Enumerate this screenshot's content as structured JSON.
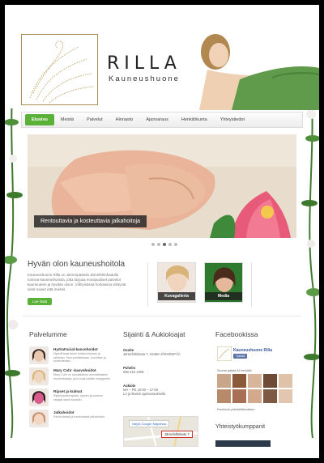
{
  "brand": {
    "name": "RILLA",
    "subtitle": "Kauneushuone"
  },
  "nav": {
    "items": [
      {
        "label": "Etusivu",
        "active": true
      },
      {
        "label": "Meistä",
        "active": false
      },
      {
        "label": "Palvelut",
        "active": false
      },
      {
        "label": "Hinnasto",
        "active": false
      },
      {
        "label": "Ajanvaraus",
        "active": false
      },
      {
        "label": "Henkilökunta",
        "active": false
      },
      {
        "label": "Yhteystiedot",
        "active": false
      }
    ]
  },
  "slider": {
    "caption": "Rentouttavia ja kosteuttavia jalkahoitoja",
    "dot_count": 5,
    "active_dot": 3
  },
  "intro": {
    "title": "Hyvän olon kauneushoitola",
    "text": "Kauneushuone Rilla on Järvenpäässä Järnefeltinkadulla toimiva kauneushoitola, joka tarjoaa monipuoliset palvelut kauneuteen ja hyvään oloon. Viihtyisässä hoitolassa viihtyvät sekä naiset että miehet.",
    "more_label": "Lue lisää"
  },
  "gallery": {
    "gallery_label": "Kuvagalleria",
    "media_label": "Media"
  },
  "services": {
    "title": "Palvelumme",
    "items": [
      {
        "name": "HydraFacial-kasvohoidot",
        "desc": "HydraFacial tekee ihosta kirkkaan ja raikkaan. Ihoa puhdistetaan, kuoritaan ja kosteutetaan."
      },
      {
        "name": "Mary Cohr -kasvohoidot",
        "desc": "Mary Cohr on ranskalainen ammattilaisten ihonhoitosarja, joka sopii kaikille ihotyypeille."
      },
      {
        "name": "Ripset ja kulmat",
        "desc": "Ripsienpidennykset, ripsien ja kulmien värjäys sekä muotoilu."
      },
      {
        "name": "Jalkahoidot",
        "desc": "Rentouttavat ja kosteuttavat jalkahoidot."
      }
    ]
  },
  "contact": {
    "title": "Sijainti & Aukioloajat",
    "address_label": "Osoite",
    "address": "Järnefeltinkatu 7, 04400 JÄRVENPÄÄ",
    "phone_label": "Puhelin",
    "phone": "050 410 1005",
    "hours_label": "Aukiolo",
    "hours": "MA – PE 10:00 – 17:00",
    "hours_note": "LA ja iltaisin ajanvarauksella",
    "map_link": "Näytä Google Mapsissa",
    "map_pin": "Järnefeltinkatu 7"
  },
  "facebook": {
    "title": "Facebookissa",
    "page_name": "Kauneushuone Rilla",
    "like_label": "Tykkää",
    "count_text": "Sivusta tykkää 94 henkilöä",
    "plugin_text": "Facebook-yhteisöliitännäinen"
  },
  "partners": {
    "title": "Yhteistyökumppanit"
  },
  "colors": {
    "accent": "#5ab038",
    "facebook": "#3b5998",
    "gold": "#a98d55"
  }
}
